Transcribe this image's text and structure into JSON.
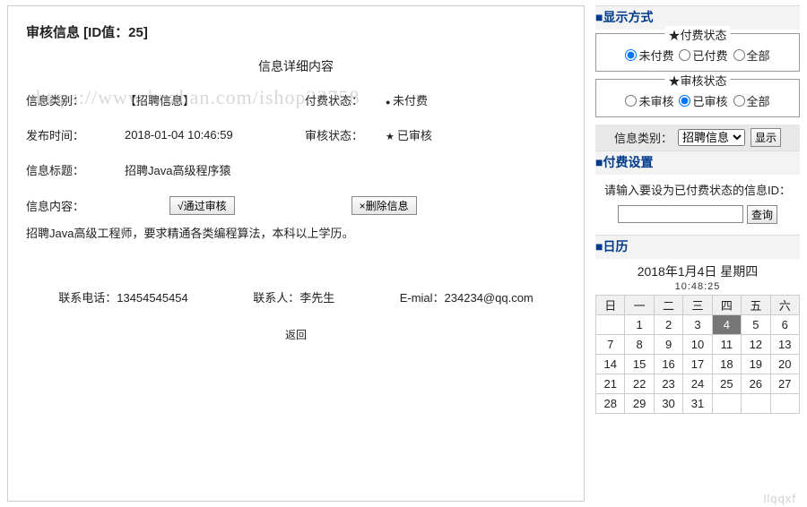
{
  "main": {
    "title": "审核信息 [ID值：25]",
    "section_header": "信息详细内容",
    "labels": {
      "category": "信息类别：",
      "paystatus": "付费状态：",
      "pubtime": "发布时间：",
      "auditstatus": "审核状态：",
      "subject": "信息标题：",
      "content": "信息内容："
    },
    "values": {
      "category": "【招聘信息】",
      "paystatus": "未付费",
      "pubtime": "2018-01-04 10:46:59",
      "auditstatus": "已审核",
      "subject": "招聘Java高级程序猿"
    },
    "buttons": {
      "approve": "√通过审核",
      "delete": "×删除信息"
    },
    "content_text": "招聘Java高级工程师，要求精通各类编程算法，本科以上学历。",
    "contact": {
      "phone_label": "联系电话：",
      "phone": "13454545454",
      "person_label": "联系人：",
      "person": "李先生",
      "email_label": "E-mial：",
      "email": "234234@qq.com"
    },
    "back": "返回"
  },
  "side": {
    "display_head": "显示方式",
    "pay_legend": "★付费状态",
    "pay_options": {
      "unpaid": "未付费",
      "paid": "已付费",
      "all": "全部"
    },
    "audit_legend": "★审核状态",
    "audit_options": {
      "unaudited": "未审核",
      "audited": "已审核",
      "all": "全部"
    },
    "category_label": "信息类别：",
    "category_selected": "招聘信息",
    "show_btn": "显示",
    "paysetting_head": "付费设置",
    "pay_desc": "请输入要设为已付费状态的信息ID：",
    "query_btn": "查询",
    "calendar_head": "日历",
    "calendar_title": "2018年1月4日 星期四",
    "calendar_time": "10:48:25",
    "weekdays": [
      "日",
      "一",
      "二",
      "三",
      "四",
      "五",
      "六"
    ],
    "today": 4,
    "month_days": 31,
    "first_weekday": 1
  },
  "watermark": "https://www.huzhan.com/ishop33758",
  "watermark2": "llqqxf"
}
